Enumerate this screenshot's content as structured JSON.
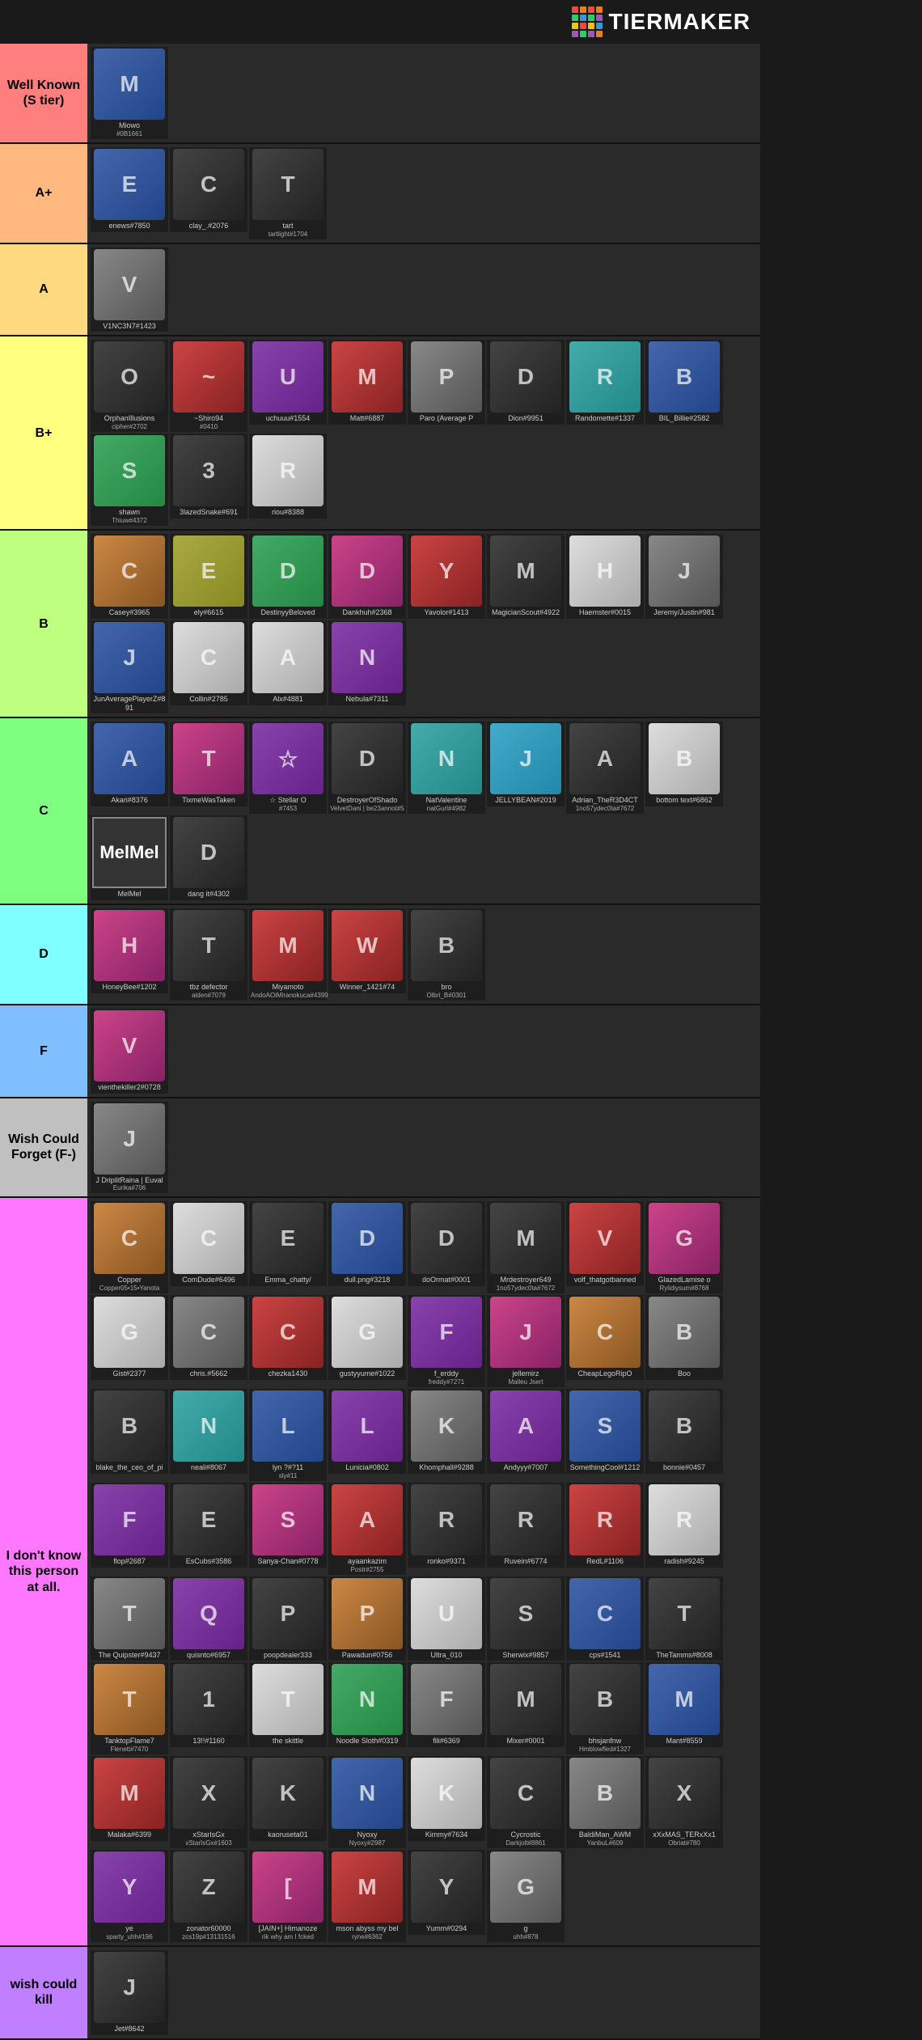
{
  "header": {
    "logo": "TiERMAkER",
    "logo_colors": [
      "#e74c3c",
      "#e67e22",
      "#f1c40f",
      "#2ecc71",
      "#3498db",
      "#9b59b6",
      "#1abc9c",
      "#e74c3c"
    ]
  },
  "tiers": [
    {
      "id": "s",
      "label": "Well Known\n(S tier)",
      "color": "#ff7f7f",
      "users": [
        {
          "name": "Miowo",
          "tag": "#0B1661",
          "color": "av-blue"
        }
      ]
    },
    {
      "id": "aplus",
      "label": "A+",
      "color": "#ffb97f",
      "users": [
        {
          "name": "enews#7850",
          "tag": "",
          "color": "av-blue"
        },
        {
          "name": "clay_.#2076",
          "tag": "",
          "color": "av-dark"
        },
        {
          "name": "tart",
          "tag": "tartlight#1704",
          "color": "av-dark"
        }
      ]
    },
    {
      "id": "a",
      "label": "A",
      "color": "#ffd97f",
      "users": [
        {
          "name": "V1NC3N7#1423",
          "tag": "",
          "color": "av-gray"
        }
      ]
    },
    {
      "id": "bplus",
      "label": "B+",
      "color": "#ffff7f",
      "users": [
        {
          "name": "OrphanIllusions",
          "tag": "cipher#2702",
          "color": "av-dark"
        },
        {
          "name": "~Shiro94",
          "tag": "#0410",
          "color": "av-red"
        },
        {
          "name": "uchuuu#1554",
          "tag": "",
          "color": "av-purple"
        },
        {
          "name": "Matt#6887",
          "tag": "",
          "color": "av-red"
        },
        {
          "name": "Paro (Average P",
          "tag": "",
          "color": "av-gray"
        },
        {
          "name": "Dion#9951",
          "tag": "",
          "color": "av-dark"
        },
        {
          "name": "Randomette#1337",
          "tag": "",
          "color": "av-teal"
        },
        {
          "name": "BIL_Billie#2582",
          "tag": "",
          "color": "av-blue"
        },
        {
          "name": "shawn",
          "tag": "Thiuw#4372",
          "color": "av-green"
        },
        {
          "name": "3lazedSnake#691",
          "tag": "",
          "color": "av-dark"
        },
        {
          "name": "riou#8388",
          "tag": "",
          "color": "av-white"
        }
      ]
    },
    {
      "id": "b",
      "label": "B",
      "color": "#bfff7f",
      "users": [
        {
          "name": "Casey#3965",
          "tag": "",
          "color": "av-orange"
        },
        {
          "name": "ely#6615",
          "tag": "",
          "color": "av-yellow"
        },
        {
          "name": "DestinyyBeloved",
          "tag": "",
          "color": "av-green"
        },
        {
          "name": "Dankhuh#2368",
          "tag": "",
          "color": "av-pink"
        },
        {
          "name": "Yavolor#1413",
          "tag": "",
          "color": "av-red"
        },
        {
          "name": "MagicianScout#4922",
          "tag": "",
          "color": "av-dark"
        },
        {
          "name": "Haemster#0015",
          "tag": "",
          "color": "av-white"
        },
        {
          "name": "Jeremy/Justin#981",
          "tag": "",
          "color": "av-gray"
        },
        {
          "name": "JunAveragePlayerZ#891",
          "tag": "",
          "color": "av-blue"
        },
        {
          "name": "Collin#2785",
          "tag": "",
          "color": "av-white"
        },
        {
          "name": "Alx#4881",
          "tag": "",
          "color": "av-white"
        },
        {
          "name": "Nebula#7311",
          "tag": "",
          "color": "av-purple"
        }
      ]
    },
    {
      "id": "c",
      "label": "C",
      "color": "#7fff7f",
      "users": [
        {
          "name": "Akari#8376",
          "tag": "",
          "color": "av-blue"
        },
        {
          "name": "TixmeWasTaken",
          "tag": "",
          "color": "av-pink"
        },
        {
          "name": "☆ Stellar O",
          "tag": "#7453",
          "color": "av-purple"
        },
        {
          "name": "DestroyerOfShado",
          "tag": "VelvetDani | be23annot#5",
          "color": "av-dark"
        },
        {
          "name": "NatValentine",
          "tag": "natGurl#4982",
          "color": "av-teal"
        },
        {
          "name": "JELLYBEAN#2019",
          "tag": "",
          "color": "av-cyan"
        },
        {
          "name": "Adrian_TheR3D4CT",
          "tag": "1no57ydec0ta#7672",
          "color": "av-dark"
        },
        {
          "name": "bottom text#6862",
          "tag": "",
          "color": "av-white"
        },
        {
          "name": "MelMel",
          "tag": "",
          "color": "av-dark",
          "special": "MelMel"
        },
        {
          "name": "dang it#4302",
          "tag": "",
          "color": "av-dark"
        }
      ]
    },
    {
      "id": "d",
      "label": "D",
      "color": "#7fffff",
      "users": [
        {
          "name": "HoneyBee#1202",
          "tag": "",
          "color": "av-pink"
        },
        {
          "name": "tbz defector",
          "tag": "aiden#7079",
          "color": "av-dark"
        },
        {
          "name": "Miyamoto",
          "tag": "AndoAOiMiranokuca#4399",
          "color": "av-red"
        },
        {
          "name": "Winner_1421#74",
          "tag": "",
          "color": "av-red"
        },
        {
          "name": "bro",
          "tag": "Olbri_B#0301",
          "color": "av-dark"
        }
      ]
    },
    {
      "id": "f",
      "label": "F",
      "color": "#7fbfff",
      "users": [
        {
          "name": "vienthekiller2#0728",
          "tag": "",
          "color": "av-pink"
        }
      ]
    },
    {
      "id": "forget",
      "label": "Wish Could\nForget (F-)",
      "color": "#c0c0c0",
      "users": [
        {
          "name": "J DriplitRaina | Euval",
          "tag": "Eurika#706",
          "color": "av-gray"
        }
      ]
    },
    {
      "id": "idk",
      "label": "I don't know\nthis person\nat all.",
      "color": "#ff77ff",
      "users": [
        {
          "name": "Copper",
          "tag": "Copper05•15•Yanota",
          "color": "av-orange"
        },
        {
          "name": "ComDude#6496",
          "tag": "",
          "color": "av-white"
        },
        {
          "name": "Emma_chatty/",
          "tag": "",
          "color": "av-dark"
        },
        {
          "name": "dull.png#3218",
          "tag": "",
          "color": "av-blue"
        },
        {
          "name": "doOrmat#0001",
          "tag": "",
          "color": "av-dark"
        },
        {
          "name": "Mrdestroyer649",
          "tag": "1no57ydec0ta#7672",
          "color": "av-dark"
        },
        {
          "name": "volf_thatgotbanned",
          "tag": "",
          "color": "av-red"
        },
        {
          "name": "GlazedLamise o",
          "tag": "Rylidiysum#8768",
          "color": "av-pink"
        },
        {
          "name": "Gist#2377",
          "tag": "",
          "color": "av-white"
        },
        {
          "name": "chris.#5662",
          "tag": "",
          "color": "av-gray"
        },
        {
          "name": "chezka1430",
          "tag": "",
          "color": "av-red"
        },
        {
          "name": "gustyyume#1022",
          "tag": "",
          "color": "av-white"
        },
        {
          "name": "f_erddy",
          "tag": "freddy#7271",
          "color": "av-purple"
        },
        {
          "name": "jellemirz",
          "tag": "Malleu Jsert",
          "color": "av-pink"
        },
        {
          "name": "CheapLegoRipO",
          "tag": "",
          "color": "av-orange"
        },
        {
          "name": "Boo",
          "tag": "",
          "color": "av-gray"
        },
        {
          "name": "blake_the_ceo_of_pi",
          "tag": "",
          "color": "av-dark"
        },
        {
          "name": "neali#8067",
          "tag": "",
          "color": "av-teal"
        },
        {
          "name": "lyn ?#?11",
          "tag": "sly#11",
          "color": "av-blue"
        },
        {
          "name": "Lunicia#0802",
          "tag": "",
          "color": "av-purple"
        },
        {
          "name": "Khomphall#9288",
          "tag": "",
          "color": "av-gray"
        },
        {
          "name": "Andyyy#7007",
          "tag": "",
          "color": "av-purple"
        },
        {
          "name": "SomethingCool#1212",
          "tag": "",
          "color": "av-blue"
        },
        {
          "name": "bonnie#0457",
          "tag": "",
          "color": "av-dark"
        },
        {
          "name": "flop#2687",
          "tag": "",
          "color": "av-purple"
        },
        {
          "name": "EsCubs#3586",
          "tag": "",
          "color": "av-dark"
        },
        {
          "name": "Sanya-Chan#0778",
          "tag": "",
          "color": "av-pink"
        },
        {
          "name": "ayaankazim",
          "tag": "Postr#2755",
          "color": "av-red"
        },
        {
          "name": "ronko#9371",
          "tag": "",
          "color": "av-dark"
        },
        {
          "name": "Ruvein#6774",
          "tag": "",
          "color": "av-dark"
        },
        {
          "name": "RedL#1106",
          "tag": "",
          "color": "av-red"
        },
        {
          "name": "radish#9245",
          "tag": "",
          "color": "av-white"
        },
        {
          "name": "The Quipster#9437",
          "tag": "",
          "color": "av-gray"
        },
        {
          "name": "quisnto#6957",
          "tag": "",
          "color": "av-purple"
        },
        {
          "name": "poopdealer333",
          "tag": "",
          "color": "av-dark"
        },
        {
          "name": "Pawadun#0756",
          "tag": "",
          "color": "av-orange"
        },
        {
          "name": "Ultra_010",
          "tag": "",
          "color": "av-white"
        },
        {
          "name": "Sherwix#9857",
          "tag": "",
          "color": "av-dark"
        },
        {
          "name": "cps#1541",
          "tag": "",
          "color": "av-blue"
        },
        {
          "name": "TheTamms#8008",
          "tag": "",
          "color": "av-dark"
        },
        {
          "name": "TanktopFlame7",
          "tag": "Flenett#7470",
          "color": "av-orange"
        },
        {
          "name": "13!!#1160",
          "tag": "",
          "color": "av-dark"
        },
        {
          "name": "the skittle",
          "tag": "",
          "color": "av-white"
        },
        {
          "name": "Noodle Sloth#0319",
          "tag": "",
          "color": "av-green"
        },
        {
          "name": "fili#6369",
          "tag": "",
          "color": "av-gray"
        },
        {
          "name": "Mixer#0001",
          "tag": "",
          "color": "av-dark"
        },
        {
          "name": "bhsjanfnw",
          "tag": "Hmblowfled#1327",
          "color": "av-dark"
        },
        {
          "name": "Mant#8559",
          "tag": "",
          "color": "av-blue"
        },
        {
          "name": "Malaka#6399",
          "tag": "",
          "color": "av-red"
        },
        {
          "name": "xStarIsGx",
          "tag": "xStarIsGx#1603",
          "color": "av-dark"
        },
        {
          "name": "kaoruseta01",
          "tag": "",
          "color": "av-dark"
        },
        {
          "name": "Nyoxy",
          "tag": "Nyoxy#2987",
          "color": "av-blue"
        },
        {
          "name": "Kimmy#7634",
          "tag": "",
          "color": "av-white"
        },
        {
          "name": "Cycrostic",
          "tag": "Darkjolt#8861",
          "color": "av-dark"
        },
        {
          "name": "BaldiMan_AWM",
          "tag": "YanbuL#609",
          "color": "av-gray"
        },
        {
          "name": "xXxMAS_TERxXx1",
          "tag": "Obriat#780",
          "color": "av-dark"
        },
        {
          "name": "ye",
          "tag": "sparty_uhh#196",
          "color": "av-purple"
        },
        {
          "name": "zonator60000",
          "tag": "zcs19p#13131516",
          "color": "av-dark"
        },
        {
          "name": "[JAIN+] Himanoze",
          "tag": "rik why am I fcked",
          "color": "av-pink"
        },
        {
          "name": "mson abyss my bel",
          "tag": "ryne#6362",
          "color": "av-red"
        },
        {
          "name": "Yumm#0294",
          "tag": "",
          "color": "av-dark"
        },
        {
          "name": "g",
          "tag": "uhh#878",
          "color": "av-gray"
        }
      ]
    },
    {
      "id": "kill",
      "label": "wish could\nkill",
      "color": "#bf7fff",
      "users": [
        {
          "name": "Jet#8642",
          "tag": "",
          "color": "av-dark"
        }
      ]
    }
  ]
}
